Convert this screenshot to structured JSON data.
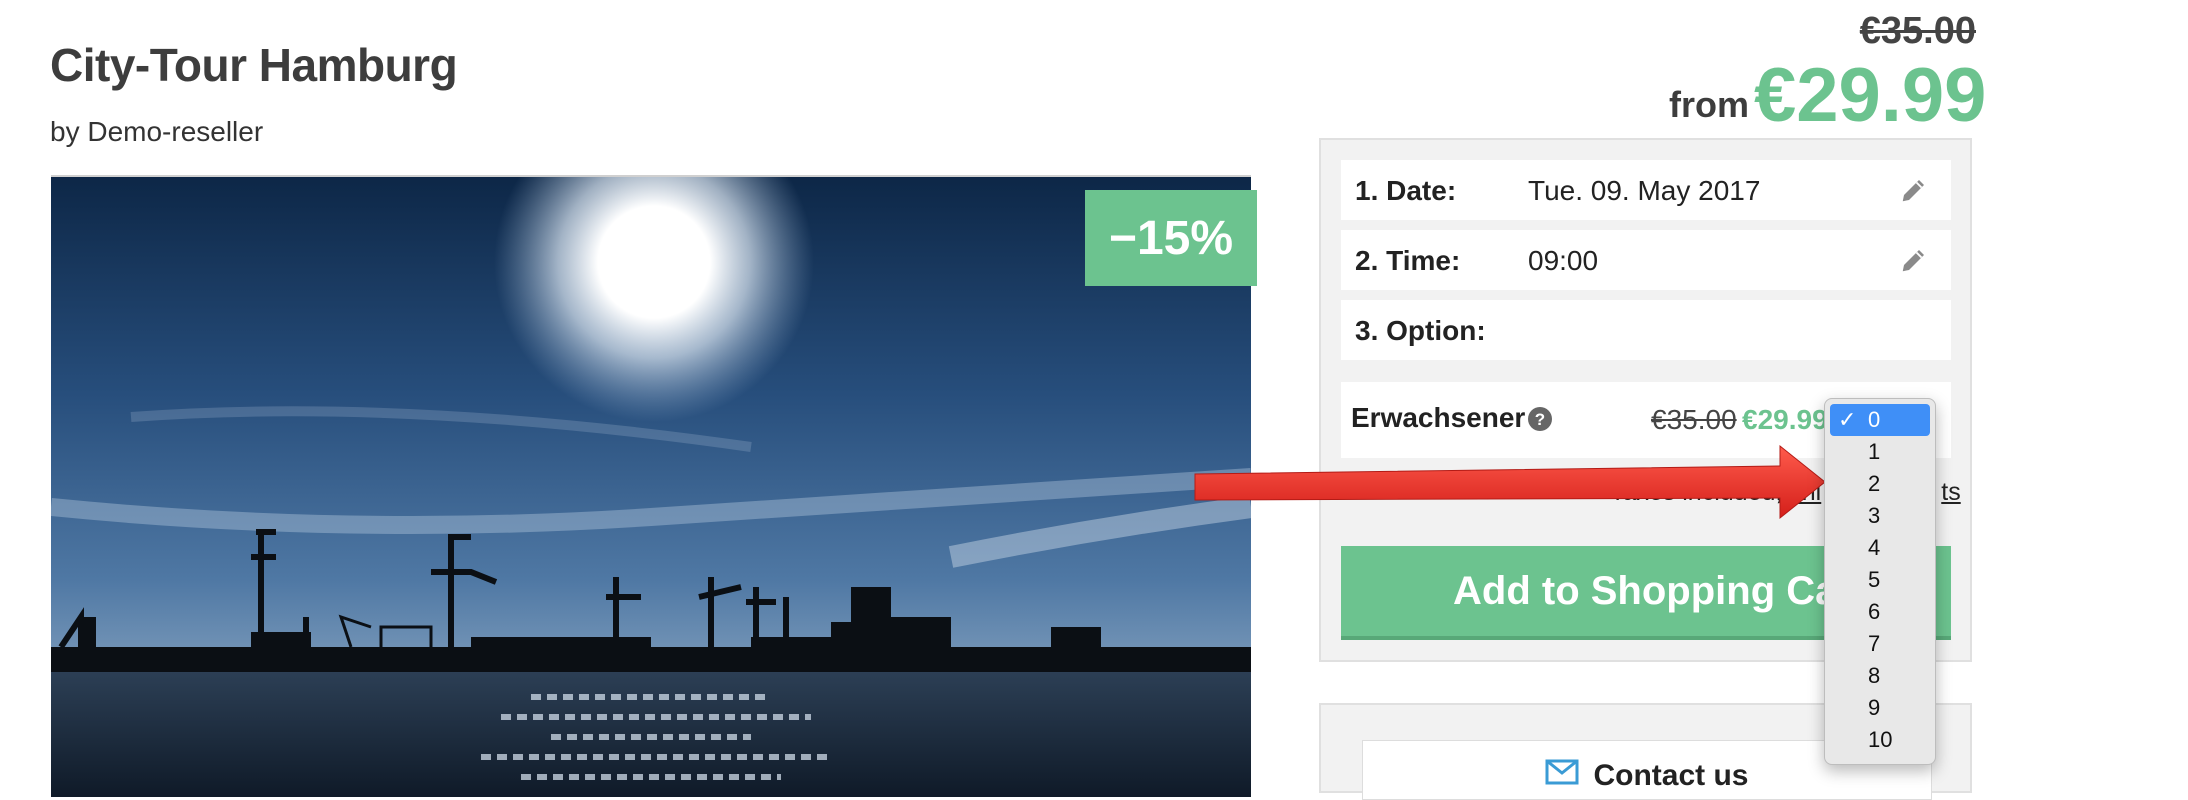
{
  "product": {
    "title": "City-Tour Hamburg",
    "byline": "by Demo-reseller",
    "discount_badge": "−15%",
    "old_price": "€35.00",
    "from_label": "from",
    "price": "€29.99"
  },
  "booking": {
    "date": {
      "label": "1. Date:",
      "value": "Tue. 09. May 2017"
    },
    "time": {
      "label": "2. Time:",
      "value": "09:00"
    },
    "option": {
      "label": "3. Option:",
      "value": ""
    },
    "ticket": {
      "name": "Erwachsener",
      "old_price": "€35.00",
      "price": "€29.99"
    },
    "taxes_text": "Taxes included,",
    "shipping_link_visible": "shi",
    "shipping_link_tail": "ts",
    "add_to_cart_label": "Add to Shopping Car"
  },
  "contact": {
    "label": "Contact us"
  },
  "quantity_dropdown": {
    "selected": "0",
    "options": [
      "0",
      "1",
      "2",
      "3",
      "4",
      "5",
      "6",
      "7",
      "8",
      "9",
      "10"
    ],
    "check_mark": "✓"
  },
  "colors": {
    "accent_green": "#6cc38f",
    "select_blue": "#3f8ff7",
    "arrow_red": "#e8302a"
  }
}
